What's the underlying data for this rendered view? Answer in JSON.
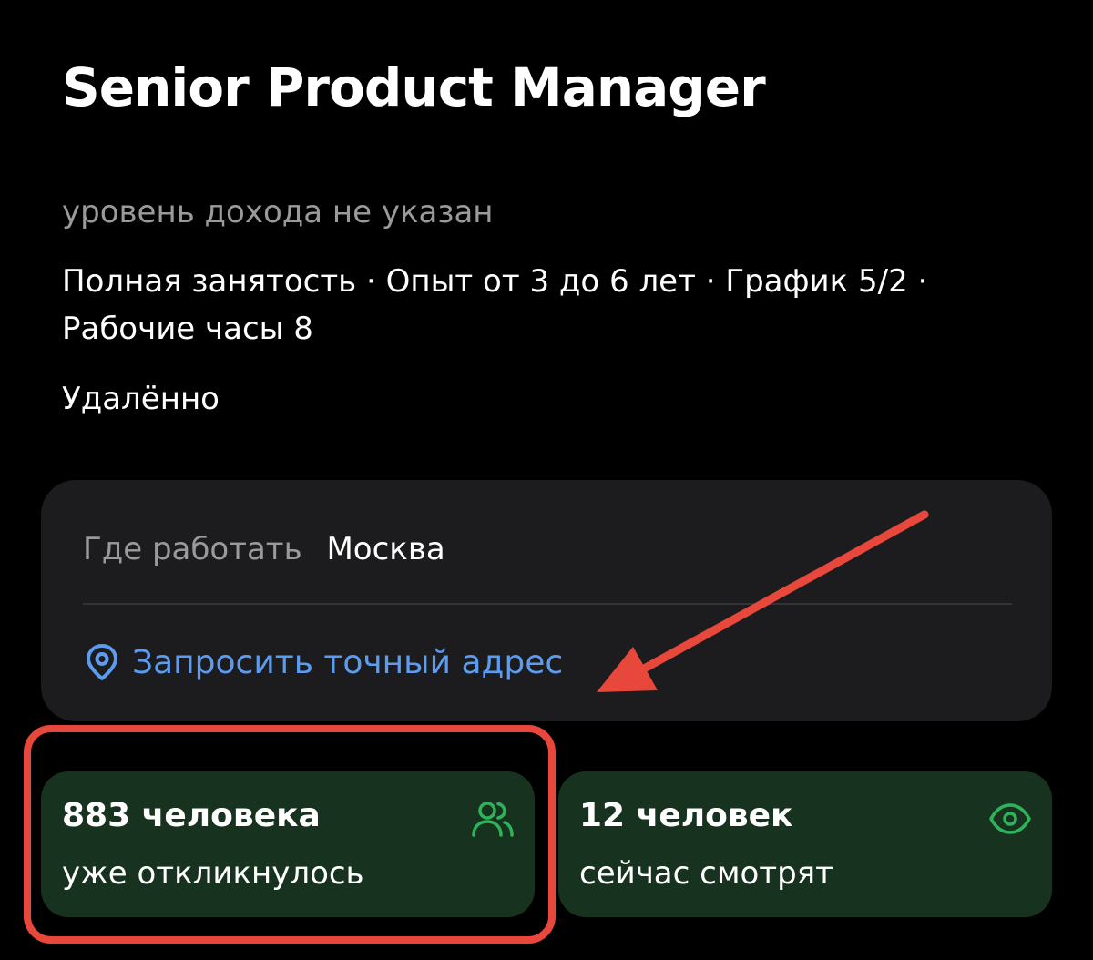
{
  "vacancy": {
    "title": "Senior Product Manager",
    "salary": "уровень дохода не указан",
    "details": "Полная занятость · Опыт от 3 до 6 лет · График 5/2 · Рабочие часы 8",
    "work_format": "Удалённо"
  },
  "location": {
    "label": "Где работать",
    "city": "Москва",
    "request_address_link": "Запросить точный адрес",
    "link_color": "#5b9bf0"
  },
  "stats": {
    "responses": {
      "count_text": "883 человека",
      "caption": "уже откликнулось",
      "icon": "people-icon"
    },
    "viewers": {
      "count_text": "12 человек",
      "caption": "сейчас смотрят",
      "icon": "eye-icon"
    },
    "card_color": "#183220",
    "icon_color": "#2fb35a"
  },
  "annotations": {
    "arrow_color": "#e8483c",
    "highlight_color": "#e8483c"
  }
}
